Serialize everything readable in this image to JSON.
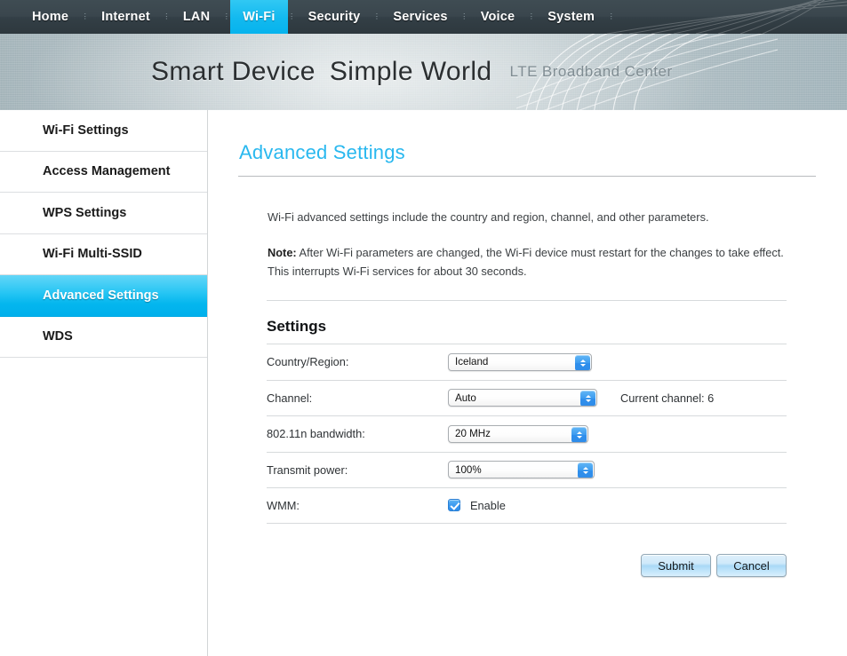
{
  "topnav": {
    "items": [
      {
        "label": "Home",
        "active": false
      },
      {
        "label": "Internet",
        "active": false
      },
      {
        "label": "LAN",
        "active": false
      },
      {
        "label": "Wi-Fi",
        "active": true
      },
      {
        "label": "Security",
        "active": false
      },
      {
        "label": "Services",
        "active": false
      },
      {
        "label": "Voice",
        "active": false
      },
      {
        "label": "System",
        "active": false
      }
    ],
    "separator": "⋮",
    "active_color": "#0fb7ef",
    "bar_color": "#36424a"
  },
  "banner": {
    "slogan_part1": "Smart Device",
    "slogan_part2": "Simple World",
    "subtitle_words": [
      "LTE",
      "Broadband",
      "Center"
    ],
    "slogan_color": "#2b2f31",
    "subtitle_color": "#7f8c92"
  },
  "sidebar": {
    "items": [
      {
        "label": "Wi-Fi Settings",
        "active": false
      },
      {
        "label": "Access Management",
        "active": false
      },
      {
        "label": "WPS Settings",
        "active": false
      },
      {
        "label": "Wi-Fi Multi-SSID",
        "active": false
      },
      {
        "label": "Advanced Settings",
        "active": true
      },
      {
        "label": "WDS",
        "active": false
      }
    ],
    "active_color": "#00b6f0"
  },
  "main": {
    "page_title": "Advanced Settings",
    "page_title_color": "#29b8ef",
    "intro": "Wi-Fi advanced settings include the country and region, channel, and other parameters.",
    "note_label": "Note:",
    "note_text": " After Wi-Fi parameters are changed, the Wi-Fi device must restart for the changes to take effect. This interrupts Wi-Fi services for about 30 seconds.",
    "section_title": "Settings",
    "rows": {
      "country": {
        "label": "Country/Region:",
        "value": "Iceland",
        "options": [
          "Iceland"
        ]
      },
      "channel": {
        "label": "Channel:",
        "value": "Auto",
        "options": [
          "Auto"
        ],
        "side_note": "Current channel: 6"
      },
      "bandwidth": {
        "label": "802.11n bandwidth:",
        "value": "20 MHz",
        "options": [
          "20 MHz"
        ]
      },
      "power": {
        "label": "Transmit power:",
        "value": "100%",
        "options": [
          "100%"
        ]
      },
      "wmm": {
        "label": "WMM:",
        "checkbox_label": "Enable",
        "checked": true
      }
    },
    "buttons": {
      "submit": "Submit",
      "cancel": "Cancel"
    }
  }
}
